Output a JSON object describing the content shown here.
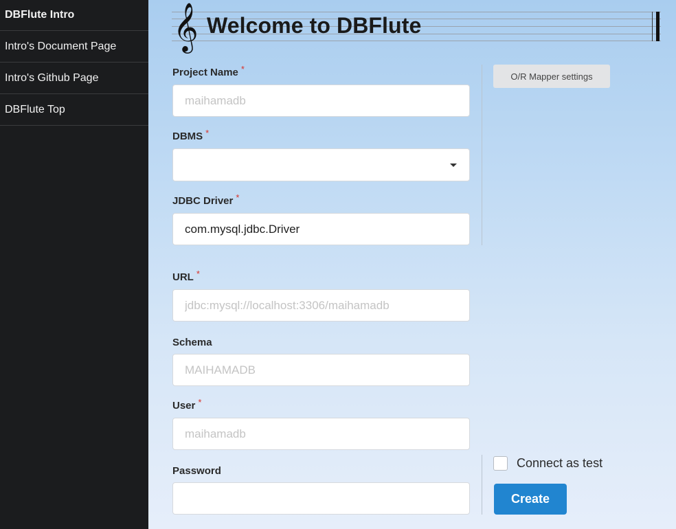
{
  "sidebar": {
    "items": [
      {
        "label": "DBFlute Intro"
      },
      {
        "label": "Intro's Document Page"
      },
      {
        "label": "Intro's Github Page"
      },
      {
        "label": "DBFlute Top"
      }
    ]
  },
  "header": {
    "clef_glyph": "𝄞",
    "title": "Welcome to DBFlute"
  },
  "form": {
    "required_mark": "*",
    "project_name": {
      "label": "Project Name",
      "value": "",
      "placeholder": "maihamadb"
    },
    "dbms": {
      "label": "DBMS",
      "value": ""
    },
    "jdbc_driver": {
      "label": "JDBC Driver",
      "value": "com.mysql.jdbc.Driver",
      "placeholder": ""
    },
    "url": {
      "label": "URL",
      "value": "",
      "placeholder": "jdbc:mysql://localhost:3306/maihamadb"
    },
    "schema": {
      "label": "Schema",
      "value": "",
      "placeholder": "MAIHAMADB"
    },
    "user": {
      "label": "User",
      "value": "",
      "placeholder": "maihamadb"
    },
    "password": {
      "label": "Password",
      "value": "",
      "placeholder": ""
    }
  },
  "settings": {
    "orm_button_label": "O/R Mapper settings"
  },
  "actions": {
    "connect_as_test_label": "Connect as test",
    "connect_as_test_checked": false,
    "create_label": "Create"
  },
  "colors": {
    "sidebar_bg": "#1b1c1e",
    "primary": "#2185d0",
    "required": "#d8342c"
  }
}
